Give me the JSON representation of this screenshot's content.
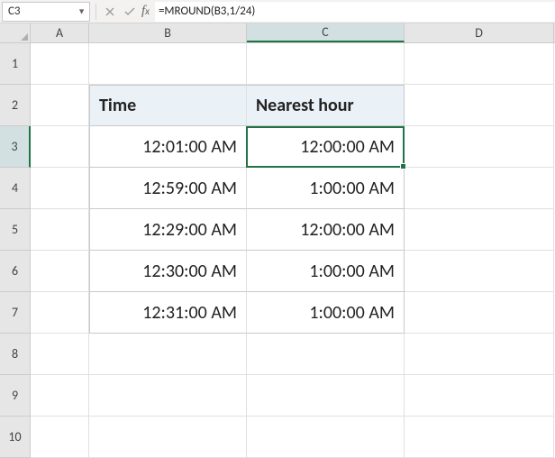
{
  "namebox": {
    "value": "C3"
  },
  "formula": "=MROUND(B3,1/24)",
  "columns": [
    "A",
    "B",
    "C",
    "D"
  ],
  "rows": [
    "1",
    "2",
    "3",
    "4",
    "5",
    "6",
    "7",
    "8",
    "9",
    "10"
  ],
  "active_col": 2,
  "active_row": 2,
  "table": {
    "headers": {
      "time": "Time",
      "nearest": "Nearest hour"
    },
    "data": [
      {
        "time": "12:01:00 AM",
        "nearest": "12:00:00 AM"
      },
      {
        "time": "12:59:00 AM",
        "nearest": "1:00:00 AM"
      },
      {
        "time": "12:29:00 AM",
        "nearest": "12:00:00 AM"
      },
      {
        "time": "12:30:00 AM",
        "nearest": "1:00:00 AM"
      },
      {
        "time": "12:31:00 AM",
        "nearest": "1:00:00 AM"
      }
    ]
  }
}
